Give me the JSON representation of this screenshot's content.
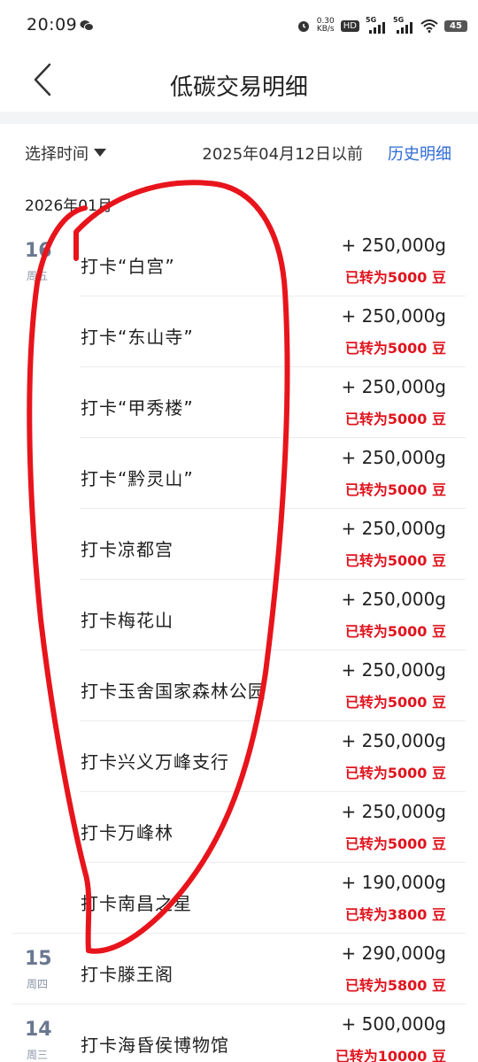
{
  "status_bar": {
    "time": "20:09",
    "net_speed_value": "0.30",
    "net_speed_unit": "KB/s",
    "hd_label": "HD",
    "sim1_label": "5G",
    "sim2_label": "5G",
    "battery": "45"
  },
  "header": {
    "title": "低碳交易明细"
  },
  "filter": {
    "select_label": "选择时间",
    "date_before": "2025年04月12日以前",
    "history_link": "历史明细"
  },
  "month_label": "2026年01月",
  "transactions": [
    {
      "day": "16",
      "weekday": "周五",
      "name": "打卡“白宫”",
      "amount": "+ 250,000g",
      "converted": "已转为5000 豆"
    },
    {
      "day": "",
      "weekday": "",
      "name": "打卡“东山寺”",
      "amount": "+ 250,000g",
      "converted": "已转为5000 豆"
    },
    {
      "day": "",
      "weekday": "",
      "name": "打卡“甲秀楼”",
      "amount": "+ 250,000g",
      "converted": "已转为5000 豆"
    },
    {
      "day": "",
      "weekday": "",
      "name": "打卡“黔灵山”",
      "amount": "+ 250,000g",
      "converted": "已转为5000 豆"
    },
    {
      "day": "",
      "weekday": "",
      "name": "打卡凉都宫",
      "amount": "+ 250,000g",
      "converted": "已转为5000 豆"
    },
    {
      "day": "",
      "weekday": "",
      "name": "打卡梅花山",
      "amount": "+ 250,000g",
      "converted": "已转为5000 豆"
    },
    {
      "day": "",
      "weekday": "",
      "name": "打卡玉舍国家森林公园",
      "amount": "+ 250,000g",
      "converted": "已转为5000 豆"
    },
    {
      "day": "",
      "weekday": "",
      "name": "打卡兴义万峰支行",
      "amount": "+ 250,000g",
      "converted": "已转为5000 豆"
    },
    {
      "day": "",
      "weekday": "",
      "name": "打卡万峰林",
      "amount": "+ 250,000g",
      "converted": "已转为5000 豆"
    },
    {
      "day": "",
      "weekday": "",
      "name": "打卡南昌之星",
      "amount": "+ 190,000g",
      "converted": "已转为3800 豆"
    },
    {
      "day": "15",
      "weekday": "周四",
      "name": "打卡滕王阁",
      "amount": "+ 290,000g",
      "converted": "已转为5800 豆"
    },
    {
      "day": "14",
      "weekday": "周三",
      "name": "打卡海昏侯博物馆",
      "amount": "+ 500,000g",
      "converted": "已转为10000 豆"
    }
  ],
  "colors": {
    "accent_blue": "#2f6bd6",
    "bean_red": "#e0141e",
    "annotation_red": "#e8141c"
  }
}
